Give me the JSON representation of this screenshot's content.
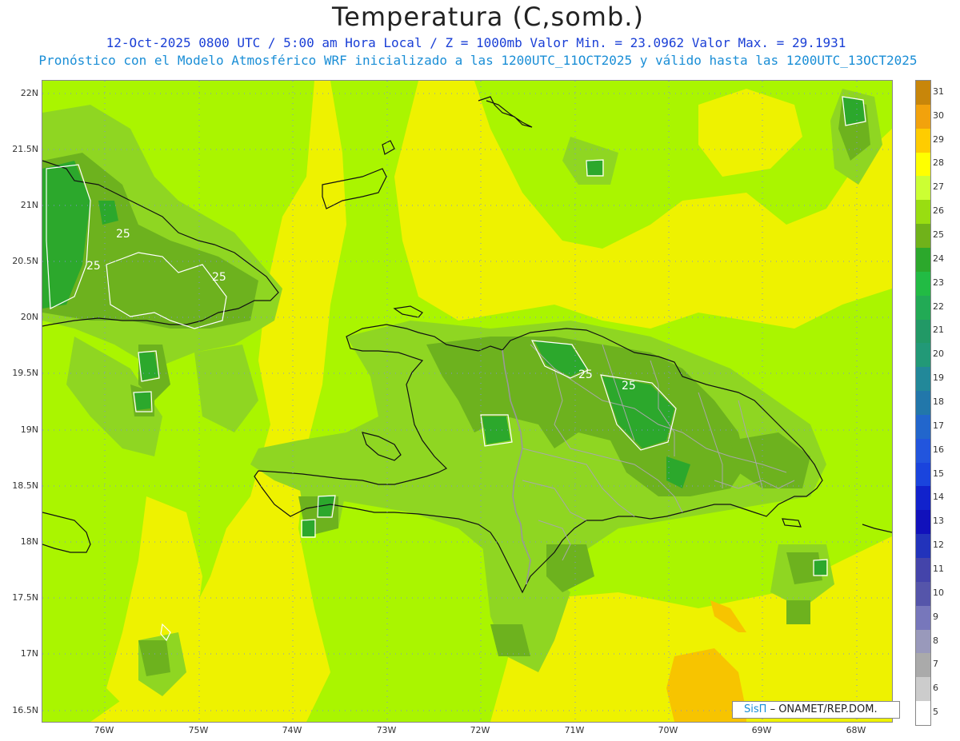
{
  "header": {
    "title": "Temperatura (C,somb.)",
    "line1": "12-Oct-2025  0800 UTC / 5:00 am Hora Local / Z = 1000mb   Valor Min. = 23.0962  Valor Max. = 29.1931",
    "line2": "Pronóstico con el Modelo Atmosférico WRF inicializado a las 1200UTC_11OCT2025 y válido hasta las  1200UTC_13OCT2025"
  },
  "axes": {
    "lat_labels": [
      "22N",
      "21.5N",
      "21N",
      "20.5N",
      "20N",
      "19.5N",
      "19N",
      "18.5N",
      "18N",
      "17.5N",
      "17N",
      "16.5N"
    ],
    "lon_labels": [
      "76W",
      "75W",
      "74W",
      "73W",
      "72W",
      "71W",
      "70W",
      "69W",
      "68W"
    ]
  },
  "map": {
    "contour_label": "25",
    "contour_labels": [
      "25",
      "25",
      "25",
      "25",
      "25"
    ]
  },
  "legend": {
    "levels": [
      "31",
      "30",
      "29",
      "28",
      "27",
      "26",
      "25",
      "24",
      "23",
      "22",
      "21",
      "20",
      "19",
      "18",
      "17",
      "16",
      "15",
      "14",
      "13",
      "12",
      "11",
      "10",
      "9",
      "8",
      "7",
      "6",
      "5"
    ],
    "colors": [
      "#c8860a",
      "#f2a20c",
      "#ffcc00",
      "#ffff00",
      "#ccff33",
      "#99dd11",
      "#70b21a",
      "#2ca82c",
      "#22bb44",
      "#22aa55",
      "#229966",
      "#229977",
      "#228899",
      "#2277aa",
      "#2266cc",
      "#2255dd",
      "#1a44dd",
      "#1122cc",
      "#1111bb",
      "#2233bb",
      "#4444aa",
      "#5555aa",
      "#7777bb",
      "#9999bb",
      "#aaaaaa",
      "#cccccc",
      "#ffffff"
    ]
  },
  "credit": {
    "brand": "SisΠ",
    "org": "– ONAMET/REP.DOM."
  }
}
